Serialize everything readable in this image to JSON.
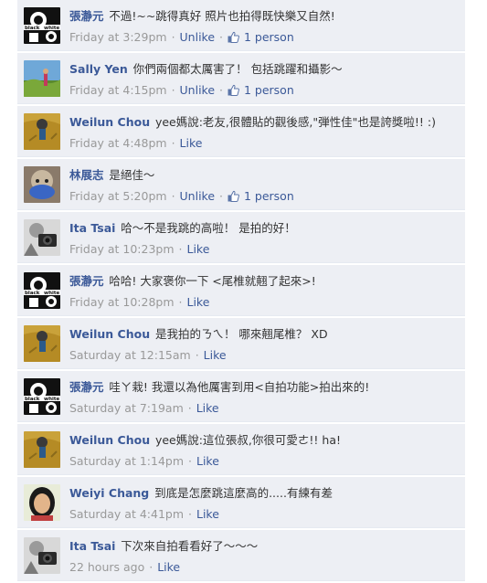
{
  "comments": [
    {
      "name": "張瀞元",
      "text": "不過!~~跳得真好 照片也拍得既快樂又自然!",
      "time": "Friday at 3:29pm",
      "action": "Unlike",
      "likes": "1 person",
      "avatar": "blackwhite-avatar"
    },
    {
      "name": "Sally Yen",
      "text": "你們兩個都太厲害了！ 包括跳躍和攝影～",
      "time": "Friday at 4:15pm",
      "action": "Unlike",
      "likes": "1 person",
      "avatar": "landscape-avatar"
    },
    {
      "name": "Weilun Chou",
      "text": "yee媽說:老友,很體貼的觀後感,\"弾性佳\"也是誇獎啦!! :)",
      "time": "Friday at 4:48pm",
      "action": "Like",
      "likes": "",
      "avatar": "field-avatar"
    },
    {
      "name": "林展志",
      "text": "是絕佳～",
      "time": "Friday at 5:20pm",
      "action": "Unlike",
      "likes": "1 person",
      "avatar": "blue-avatar"
    },
    {
      "name": "Ita Tsai",
      "text": "哈～不是我跳的高啦！ 是拍的好！",
      "time": "Friday at 10:23pm",
      "action": "Like",
      "likes": "",
      "avatar": "camera-avatar"
    },
    {
      "name": "張瀞元",
      "text": "哈哈! 大家褒你一下 <尾椎就翹了起來>!",
      "time": "Friday at 10:28pm",
      "action": "Like",
      "likes": "",
      "avatar": "blackwhite-avatar"
    },
    {
      "name": "Weilun Chou",
      "text": "是我拍的ㄋㄟ！ 哪來翹尾椎？ XD",
      "time": "Saturday at 12:15am",
      "action": "Like",
      "likes": "",
      "avatar": "field-avatar"
    },
    {
      "name": "張瀞元",
      "text": "哇ㄚ栽! 我還以為他厲害到用<自拍功能>拍出來的!",
      "time": "Saturday at 7:19am",
      "action": "Like",
      "likes": "",
      "avatar": "blackwhite-avatar"
    },
    {
      "name": "Weilun Chou",
      "text": "yee媽說:這位張叔,你很可愛ㄜ!! ha!",
      "time": "Saturday at 1:14pm",
      "action": "Like",
      "likes": "",
      "avatar": "field-avatar"
    },
    {
      "name": "Weiyi Chang",
      "text": "到底是怎麼跳這麼高的.....有練有差",
      "time": "Saturday at 4:41pm",
      "action": "Like",
      "likes": "",
      "avatar": "person-avatar"
    },
    {
      "name": "Ita Tsai",
      "text": "下次來自拍看看好了～～～",
      "time": "22 hours ago",
      "action": "Like",
      "likes": "",
      "avatar": "camera-avatar"
    }
  ],
  "colors": {
    "link": "#3b5998",
    "meta": "#999999",
    "bg": "#edeff4"
  }
}
